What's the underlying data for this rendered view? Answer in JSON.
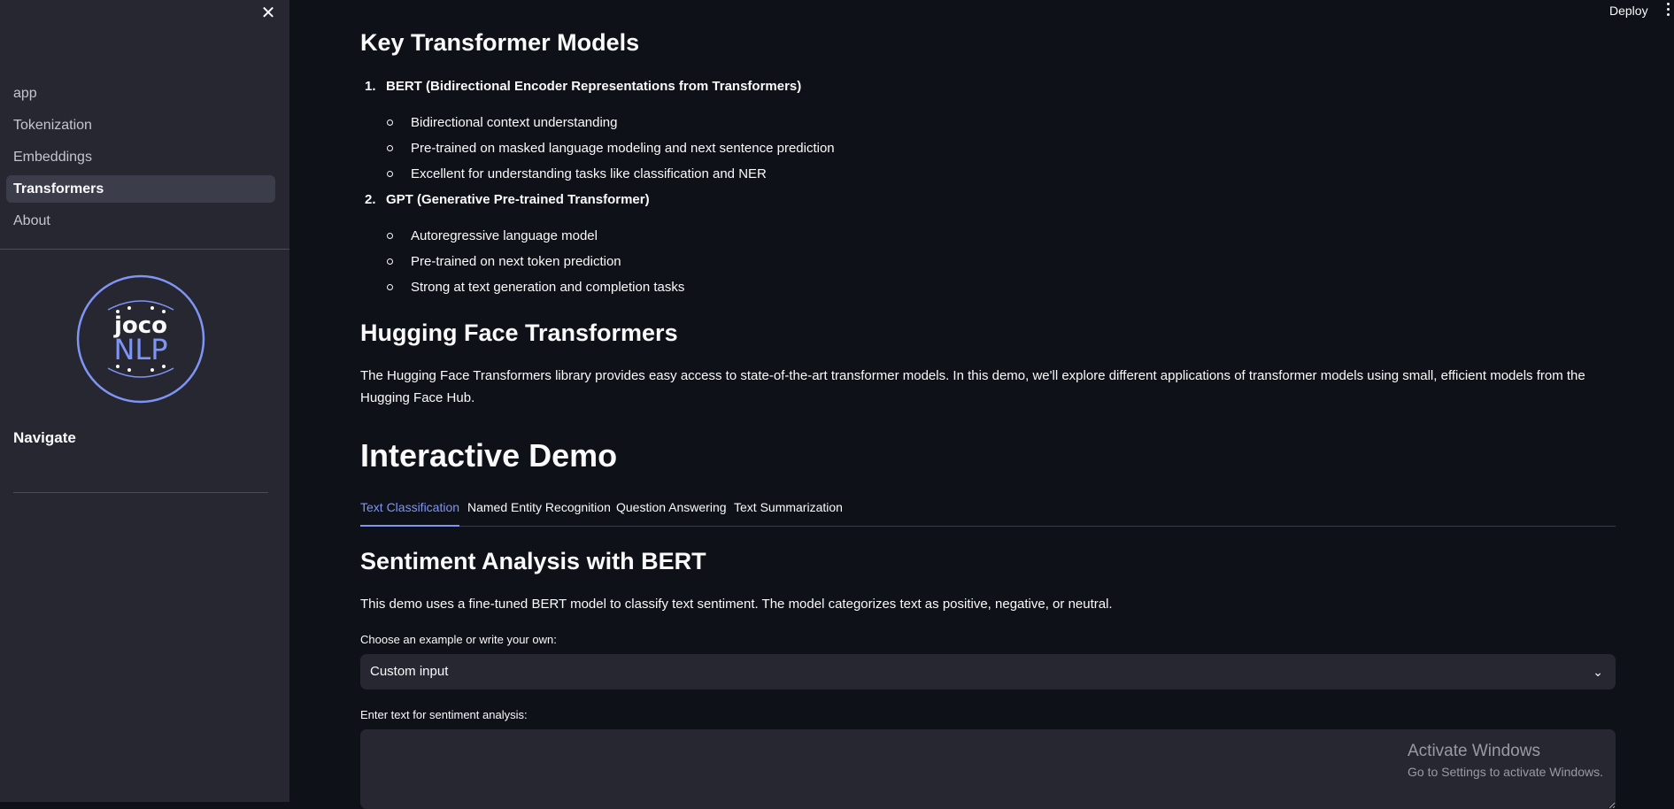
{
  "sidebar": {
    "close_icon": "close-icon",
    "nav_items": [
      {
        "label": "app",
        "active": false
      },
      {
        "label": "Tokenization",
        "active": false
      },
      {
        "label": "Embeddings",
        "active": false
      },
      {
        "label": "Transformers",
        "active": true
      },
      {
        "label": "About",
        "active": false
      }
    ],
    "logo": {
      "top_text": "joco",
      "bottom_text": "NLP",
      "color": "#7f95f5"
    },
    "navigate_title": "Navigate"
  },
  "header": {
    "deploy_label": "Deploy",
    "menu_icon": "kebab-menu-icon"
  },
  "main": {
    "key_models_title": "Key Transformer Models",
    "models": [
      {
        "number": "1.",
        "name": "BERT (Bidirectional Encoder Representations from Transformers)",
        "bullets": [
          "Bidirectional context understanding",
          "Pre-trained on masked language modeling and next sentence prediction",
          "Excellent for understanding tasks like classification and NER"
        ]
      },
      {
        "number": "2.",
        "name": "GPT (Generative Pre-trained Transformer)",
        "bullets": [
          "Autoregressive language model",
          "Pre-trained on next token prediction",
          "Strong at text generation and completion tasks"
        ]
      }
    ],
    "hf_title": "Hugging Face Transformers",
    "hf_paragraph": "The Hugging Face Transformers library provides easy access to state-of-the-art transformer models. In this demo, we'll explore different applications of transformer models using small, efficient models from the Hugging Face Hub.",
    "demo_title": "Interactive Demo",
    "tabs": [
      {
        "label": "Text Classification",
        "active": true
      },
      {
        "label": "Named Entity Recognition",
        "active": false
      },
      {
        "label": "Question Answering",
        "active": false
      },
      {
        "label": "Text Summarization",
        "active": false
      }
    ],
    "sentiment_title": "Sentiment Analysis with BERT",
    "sentiment_desc": "This demo uses a fine-tuned BERT model to classify text sentiment. The model categorizes text as positive, negative, or neutral.",
    "example_label": "Choose an example or write your own:",
    "example_value": "Custom input",
    "text_label": "Enter text for sentiment analysis:",
    "text_value": ""
  },
  "watermark": {
    "line1": "Activate Windows",
    "line2": "Go to Settings to activate Windows."
  },
  "colors": {
    "background": "#0e1117",
    "sidebar": "#262730",
    "accent": "#7f95f5"
  }
}
